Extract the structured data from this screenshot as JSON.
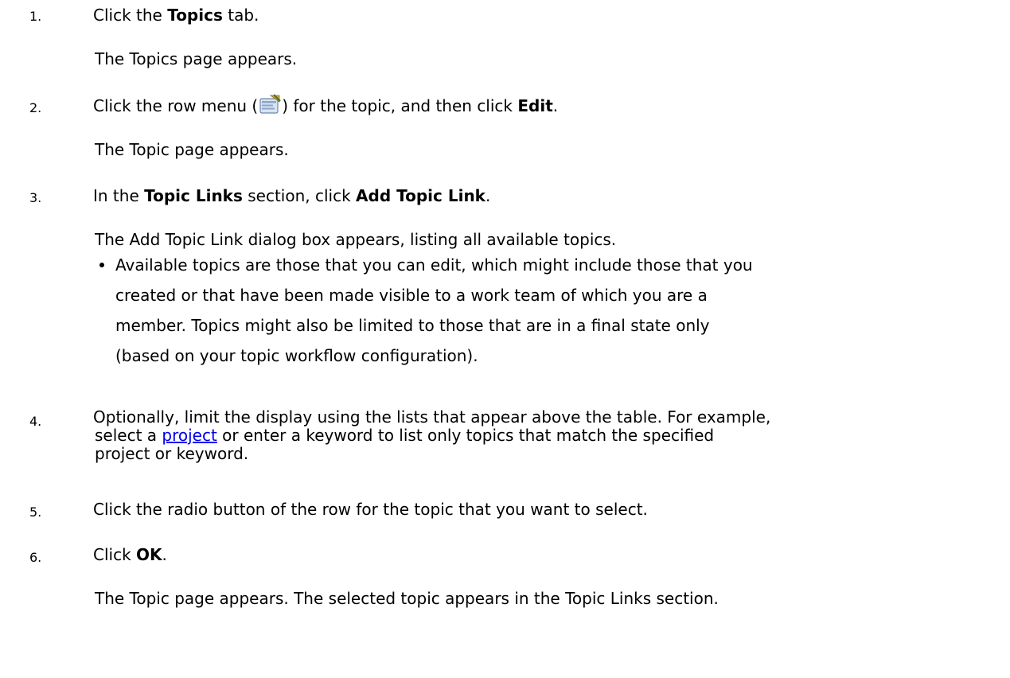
{
  "steps": [
    {
      "number": "1.",
      "pre": "Click the ",
      "bold": "Topics",
      "post": " tab.",
      "result": "The Topics page appears."
    },
    {
      "number": "2.",
      "pre": "Click the row menu (",
      "mid": ") for the topic, and then click ",
      "bold": "Edit",
      "post": ".",
      "icon": "row-menu-icon",
      "result": "The Topic page appears."
    },
    {
      "number": "3.",
      "pre": "In the ",
      "bold1": "Topic Links",
      "mid": " section, click ",
      "bold2": "Add Topic Link",
      "post": ".",
      "result": "The Add Topic Link dialog box appears, listing all available topics.",
      "bullet": [
        "Available topics are those that you can edit, which might include those that you",
        "created or that have been made visible to a work team of which you are a",
        "member. Topics might also be limited to those that are in a final state only",
        "(based on your topic workflow configuration)."
      ]
    },
    {
      "number": "4.",
      "line1": "Optionally, limit the display using the lists that appear above the table. For example,",
      "line2_pre": "select a ",
      "link": "project",
      "line2_post": " or enter a keyword to list only topics that match the specified",
      "line3": "project or keyword."
    },
    {
      "number": "5.",
      "text": "Click the radio button of the row for the topic that you want to select."
    },
    {
      "number": "6.",
      "pre": "Click ",
      "bold": "OK",
      "post": ".",
      "result": "The Topic page appears. The selected topic appears in the Topic Links section."
    }
  ]
}
